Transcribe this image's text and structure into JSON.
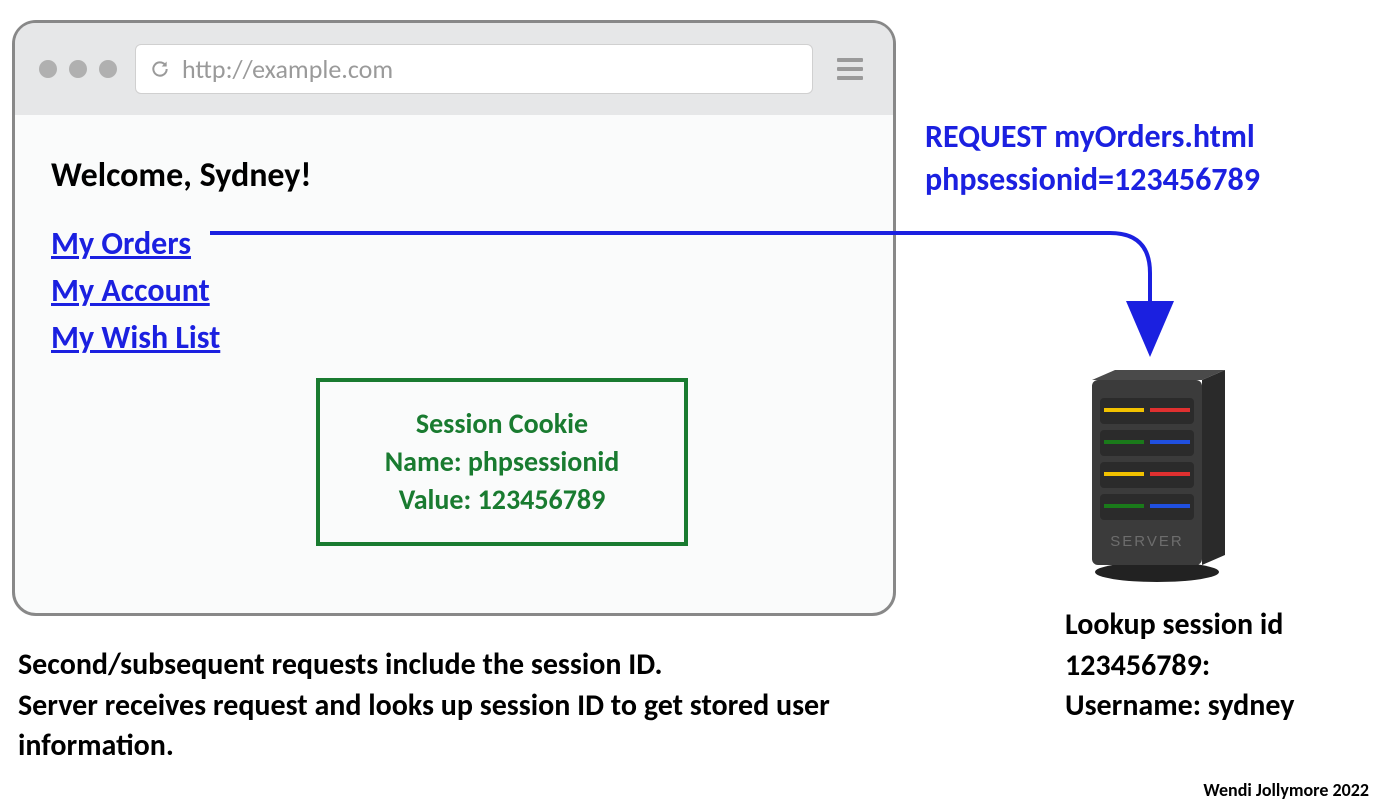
{
  "browser": {
    "url": "http://example.com",
    "welcome": "Welcome, Sydney!",
    "links": {
      "orders": "My Orders",
      "account": "My Account",
      "wishlist": "My Wish List"
    }
  },
  "cookie": {
    "title": "Session Cookie",
    "name_line": "Name: phpsessionid",
    "value_line": "Value: 123456789"
  },
  "request": {
    "line1": "REQUEST myOrders.html",
    "line2": "phpsessionid=123456789"
  },
  "server_lookup": {
    "line1": "Lookup session id",
    "line2": "123456789:",
    "line3": "Username: sydney"
  },
  "explanation": {
    "line1": "Second/subsequent requests include the session ID.",
    "line2": "Server receives request and looks up session ID to get stored user information."
  },
  "credit": "Wendi Jollymore 2022"
}
